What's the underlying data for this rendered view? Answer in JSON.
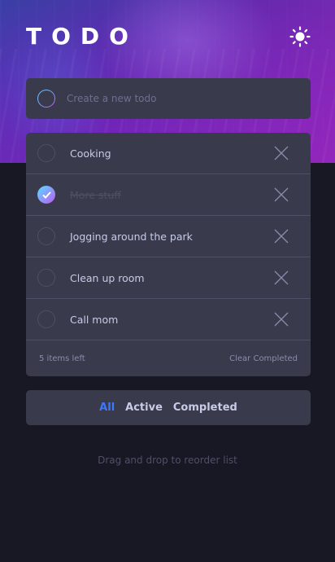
{
  "app": {
    "title": "TODO",
    "theme_icon": "sun-icon"
  },
  "new_todo": {
    "placeholder": "Create a new todo"
  },
  "todos": [
    {
      "text": "Cooking",
      "completed": false
    },
    {
      "text": "More stuff",
      "completed": true
    },
    {
      "text": "Jogging around the park",
      "completed": false
    },
    {
      "text": "Clean up room",
      "completed": false
    },
    {
      "text": "Call mom",
      "completed": false
    }
  ],
  "footer": {
    "items_left": "5 items left",
    "clear_label": "Clear Completed"
  },
  "filters": {
    "all": "All",
    "active": "Active",
    "completed": "Completed",
    "selected": "All"
  },
  "hint": "Drag and drop to reorder list",
  "colors": {
    "accent": "#3a7bfd",
    "check_gradient_start": "#57ddff",
    "check_gradient_end": "#c058f3",
    "card": "#393a4c",
    "background": "#181824"
  },
  "icons": {
    "delete": "close-icon",
    "check": "check-icon"
  }
}
